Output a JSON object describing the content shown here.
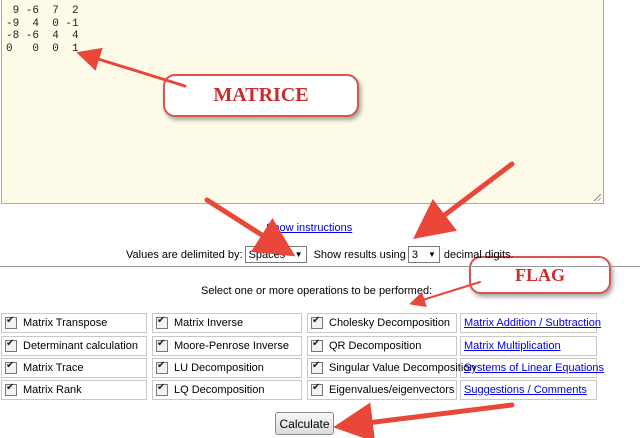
{
  "matrix": {
    "rows": [
      " 9 -6  7  2",
      "-9  4  0 -1",
      "-8 -6  4  4",
      "0   0  0  1"
    ]
  },
  "callouts": {
    "matrix_label": "MATRICE",
    "flag_label": "FLAG"
  },
  "instructions_link": "Show instructions",
  "options": {
    "delimited_label": "Values are delimited by:",
    "delimiter_value": "Spaces",
    "results_label": "Show results using",
    "digits_value": "3",
    "digits_suffix": "decimal digits."
  },
  "select_prompt": "Select one or more operations to be performed:",
  "operations": [
    [
      "Matrix Transpose",
      "Matrix Inverse",
      "Cholesky Decomposition"
    ],
    [
      "Determinant calculation",
      "Moore-Penrose Inverse",
      "QR Decomposition"
    ],
    [
      "Matrix Trace",
      "LU Decomposition",
      "Singular Value Decomposition"
    ],
    [
      "Matrix Rank",
      "LQ Decomposition",
      "Eigenvalues/eigenvectors"
    ]
  ],
  "links": [
    "Matrix Addition / Subtraction",
    "Matrix Multiplication",
    "Systems of Linear Equations",
    "Suggestions / Comments"
  ],
  "calculate_label": "Calculate",
  "colors": {
    "arrow": "#e8473a",
    "callout_text": "#cc2b2b",
    "textarea_bg": "#fdfbe8",
    "link": "#0000ee"
  }
}
